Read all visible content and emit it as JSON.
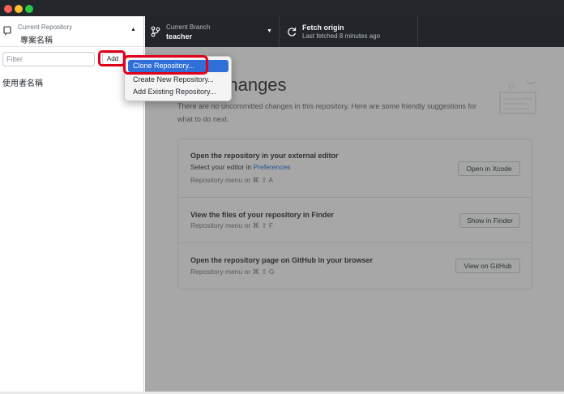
{
  "window": {
    "controls": [
      "close",
      "minimize",
      "maximize"
    ]
  },
  "sidebar": {
    "repo_label": "Current Repository",
    "repo_name": "專案名稱",
    "filter_placeholder": "Filter",
    "add_label": "Add",
    "user_label": "使用者名稱"
  },
  "toolbar": {
    "branch_label": "Current Branch",
    "branch_value": "teacher",
    "fetch_title": "Fetch origin",
    "fetch_subtitle": "Last fetched 8 minutes ago"
  },
  "add_menu": {
    "items": [
      {
        "label": "Clone Repository...",
        "selected": true
      },
      {
        "label": "Create New Repository..."
      },
      {
        "label": "Add Existing Repository..."
      }
    ]
  },
  "main": {
    "title": "local changes",
    "description": "There are no uncommitted changes in this repository. Here are some friendly suggestions for what to do next.",
    "cards": [
      {
        "title": "Open the repository in your external editor",
        "line_prefix": "Select your editor in ",
        "line_link": "Preferences",
        "shortcut": "Repository menu or ⌘ ⇧ A",
        "button": "Open in Xcode"
      },
      {
        "title": "View the files of your repository in Finder",
        "shortcut": "Repository menu or ⌘ ⇧ F",
        "button": "Show in Finder"
      },
      {
        "title": "Open the repository page on GitHub in your browser",
        "shortcut": "Repository menu or ⌘ ⇧ G",
        "button": "View on GitHub"
      }
    ]
  },
  "colors": {
    "toolbar_bg": "#24292e",
    "highlight_red": "#e0001b",
    "menu_selected": "#2f6fd8",
    "link": "#0366d6"
  },
  "icons": [
    "repo-icon",
    "branch-icon",
    "fetch-icon",
    "caret-down-icon",
    "illustration"
  ]
}
